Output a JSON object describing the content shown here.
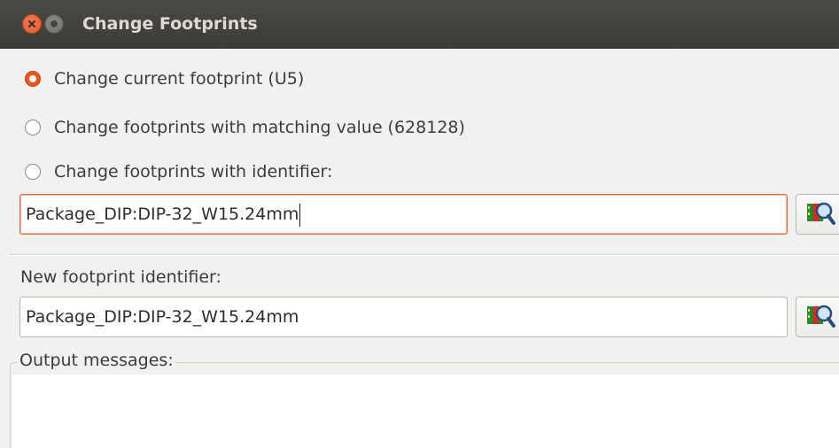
{
  "window": {
    "title": "Change Footprints"
  },
  "options": {
    "change_current": "Change current footprint (U5)",
    "change_matching_value": "Change footprints with matching value (628128)",
    "change_identifier": "Change footprints with identifier:"
  },
  "identifier_field": {
    "value": "Package_DIP:DIP-32_W15.24mm"
  },
  "new_footprint": {
    "label": "New footprint identifier:",
    "value": "Package_DIP:DIP-32_W15.24mm"
  },
  "output": {
    "label": "Output messages:"
  },
  "icons": {
    "close": "close-icon",
    "minimize": "minimize-icon",
    "browse": "footprint-browser-icon"
  },
  "colors": {
    "accent": "#e95420",
    "titlebar": "#3c3b37"
  }
}
